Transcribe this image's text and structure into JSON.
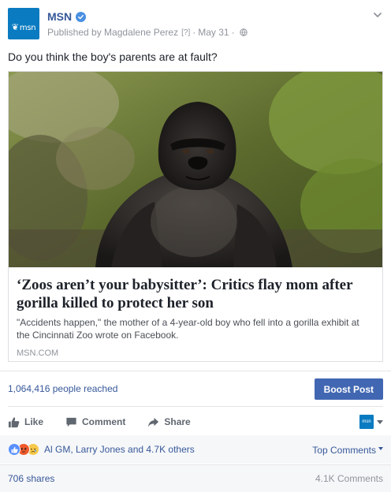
{
  "post": {
    "page_name": "MSN",
    "avatar_text": "msn",
    "published_by": "Published by Magdalene Perez",
    "help_marker": "[?]",
    "separator": "·",
    "date": "May 31",
    "status_text": "Do you think the boy's parents are at fault?"
  },
  "link_card": {
    "title": "‘Zoos aren’t your babysitter’: Critics flay mom after gorilla killed to protect her son",
    "description": "\"Accidents happen,\" the mother of a 4-year-old boy who fell into a gorilla exhibit at the Cincinnati Zoo wrote on Facebook.",
    "source": "MSN.COM"
  },
  "insights": {
    "reach_text": "1,064,416 people reached",
    "boost_label": "Boost Post"
  },
  "actions": {
    "like_label": "Like",
    "comment_label": "Comment",
    "share_label": "Share"
  },
  "reactions": {
    "summary": "Al GM, Larry Jones and 4.7K others",
    "sort_label": "Top Comments",
    "types": [
      "like",
      "angry",
      "sad"
    ]
  },
  "footer": {
    "shares": "706 shares",
    "comments": "4.1K Comments"
  },
  "colors": {
    "link_blue": "#365899",
    "boost_blue": "#4267b2",
    "msn_brand": "#0a7bc1",
    "verified": "#4a90e2"
  }
}
